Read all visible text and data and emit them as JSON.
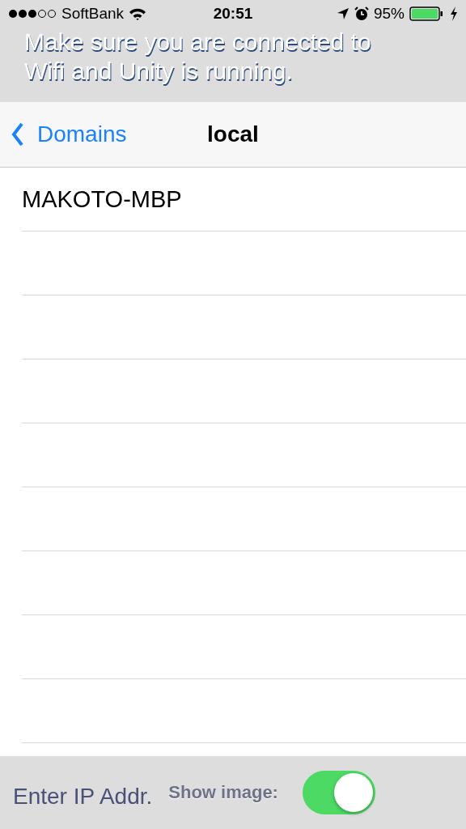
{
  "status_bar": {
    "carrier": "SoftBank",
    "time": "20:51",
    "battery": "95%"
  },
  "hint": "Make sure you are connected to Wifi and Unity is running.",
  "nav": {
    "back": "Domains",
    "title": "local"
  },
  "hosts": [
    {
      "name": "MAKOTO-MBP"
    }
  ],
  "bottom": {
    "ip_button": "Enter IP Addr.",
    "show_image_label": "Show image:",
    "show_image": {
      "on": true
    }
  }
}
